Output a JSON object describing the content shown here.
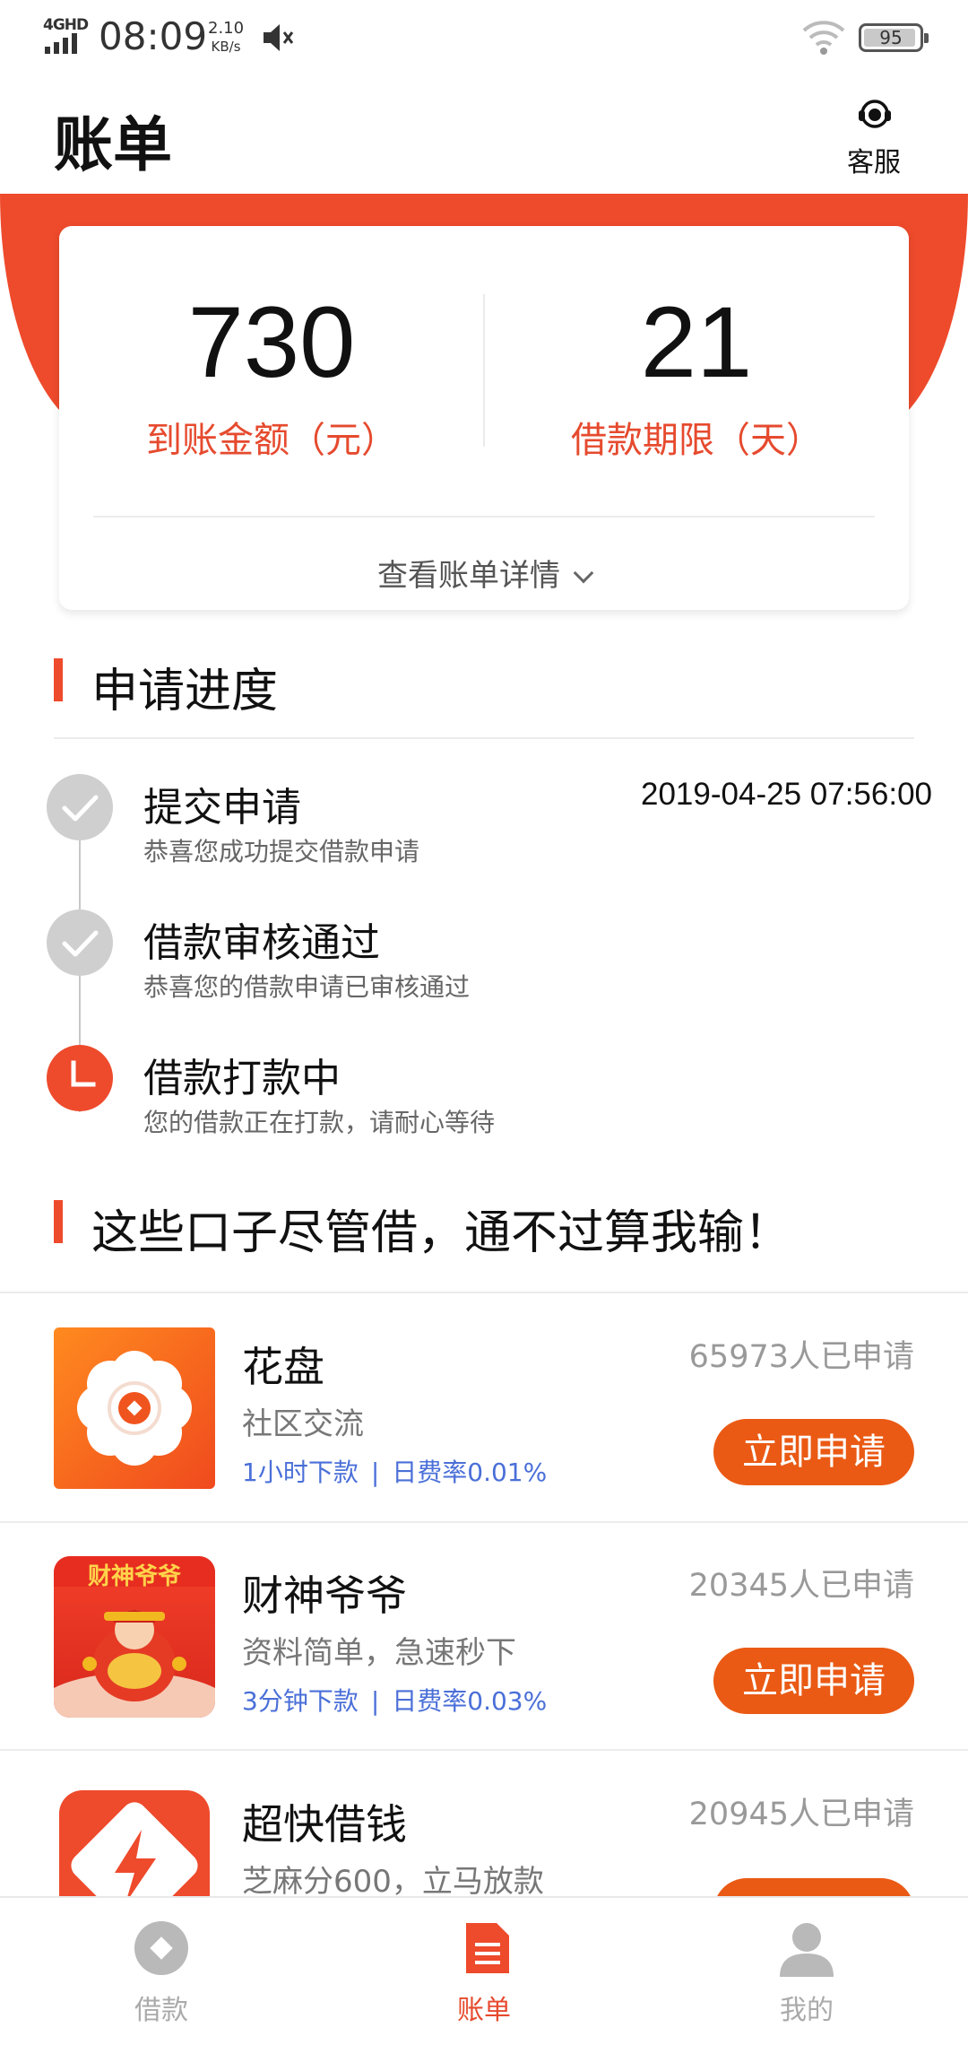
{
  "status_bar": {
    "network": "4GHD",
    "time": "08:09",
    "speed_value": "2.10",
    "speed_unit": "KB/s",
    "battery": "95",
    "battery_level": 0.95
  },
  "header": {
    "title": "账单",
    "service_label": "客服"
  },
  "summary": {
    "amount_value": "730",
    "amount_label": "到账金额（元）",
    "term_value": "21",
    "term_label": "借款期限（天）",
    "detail_link": "查看账单详情"
  },
  "progress": {
    "section_title": "申请进度",
    "steps": [
      {
        "title": "提交申请",
        "subtitle": "恭喜您成功提交借款申请",
        "time": "2019-04-25 07:56:00",
        "status": "done"
      },
      {
        "title": "借款审核通过",
        "subtitle": "恭喜您的借款申请已审核通过",
        "status": "done"
      },
      {
        "title": "借款打款中",
        "subtitle": "您的借款正在打款，请耐心等待",
        "status": "pending"
      }
    ]
  },
  "recommend": {
    "section_title": "这些口子尽管借，通不过算我输！",
    "items": [
      {
        "name": "花盘",
        "desc": "社区交流",
        "tag1": "1小时下款",
        "tag_sep": "|",
        "tag2": "日费率0.01%",
        "count": "65973人已申请",
        "button": "立即申请"
      },
      {
        "name": "财神爷爷",
        "desc": "资料简单，急速秒下",
        "tag1": "3分钟下款",
        "tag_sep": "|",
        "tag2": "日费率0.03%",
        "count": "20345人已申请",
        "button": "立即申请",
        "logo_text": "财神爷爷"
      },
      {
        "name": "超快借钱",
        "desc": "芝麻分600，立马放款",
        "count": "20945人已申请"
      }
    ]
  },
  "nav": {
    "items": [
      {
        "label": "借款"
      },
      {
        "label": "账单",
        "active": true
      },
      {
        "label": "我的"
      }
    ]
  },
  "colors": {
    "accent": "#ee4a2c",
    "button": "#ea5a14",
    "tag_blue": "#4a6fd8"
  }
}
